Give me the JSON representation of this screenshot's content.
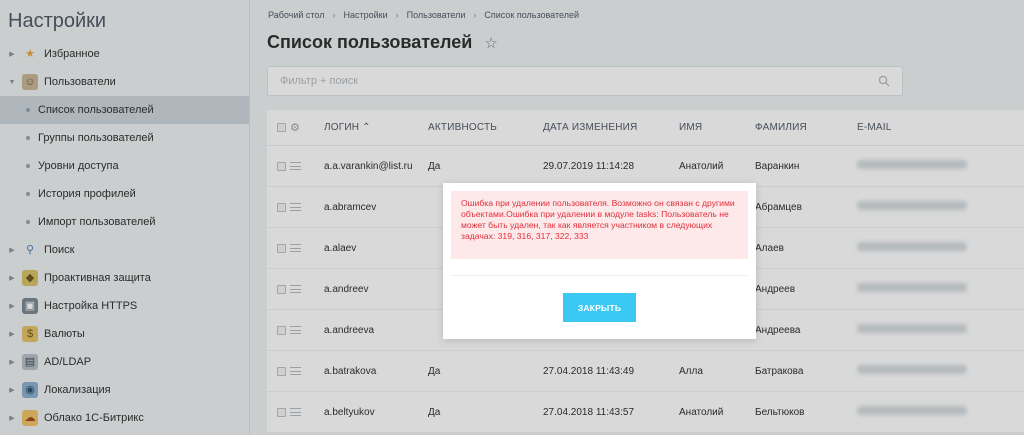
{
  "sidebar": {
    "title": "Настройки",
    "items": [
      {
        "label": "Избранное",
        "icon": "star-icon",
        "expanded": false
      },
      {
        "label": "Пользователи",
        "icon": "user-icon",
        "expanded": true
      },
      {
        "label": "Список пользователей",
        "sub": true,
        "active": true
      },
      {
        "label": "Группы пользователей",
        "sub": true
      },
      {
        "label": "Уровни доступа",
        "sub": true
      },
      {
        "label": "История профилей",
        "sub": true
      },
      {
        "label": "Импорт пользователей",
        "sub": true
      },
      {
        "label": "Поиск",
        "icon": "search-icon",
        "expanded": false
      },
      {
        "label": "Проактивная защита",
        "icon": "shield-icon",
        "expanded": false
      },
      {
        "label": "Настройка HTTPS",
        "icon": "lock-icon",
        "expanded": false
      },
      {
        "label": "Валюты",
        "icon": "currency-icon",
        "expanded": false
      },
      {
        "label": "AD/LDAP",
        "icon": "ldap-icon",
        "expanded": false
      },
      {
        "label": "Локализация",
        "icon": "globe-icon",
        "expanded": false
      },
      {
        "label": "Облако 1С-Битрикс",
        "icon": "cloud-icon",
        "expanded": false
      }
    ]
  },
  "breadcrumb": [
    "Рабочий стол",
    "Настройки",
    "Пользователи",
    "Список пользователей"
  ],
  "page": {
    "title": "Список пользователей"
  },
  "filter": {
    "placeholder": "Фильтр + поиск"
  },
  "table": {
    "columns": {
      "login": "ЛОГИН",
      "active": "АКТИВНОСТЬ",
      "date": "ДАТА ИЗМЕНЕНИЯ",
      "name": "ИМЯ",
      "last": "ФАМИЛИЯ",
      "email": "E-MAIL"
    },
    "rows": [
      {
        "login": "a.a.varankin@list.ru",
        "active": "Да",
        "date": "29.07.2019 11:14:28",
        "name": "Анатолий",
        "last": "Варанкин"
      },
      {
        "login": "a.abramcev",
        "active": "",
        "date": "",
        "name": "",
        "last": "Абрамцев"
      },
      {
        "login": "a.alaev",
        "active": "",
        "date": "",
        "name": "",
        "last": "Алаев"
      },
      {
        "login": "a.andreev",
        "active": "",
        "date": "",
        "name": "",
        "last": "Андреев"
      },
      {
        "login": "a.andreeva",
        "active": "",
        "date": "",
        "name": "",
        "last": "Андреева"
      },
      {
        "login": "a.batrakova",
        "active": "Да",
        "date": "27.04.2018 11:43:49",
        "name": "Алла",
        "last": "Батракова"
      },
      {
        "login": "a.beltyukov",
        "active": "Да",
        "date": "27.04.2018 11:43:57",
        "name": "Анатолий",
        "last": "Бельтюков"
      }
    ]
  },
  "modal": {
    "error": "Ошибка при удалении пользователя. Возможно он связан с другими объектами.Ошибка при удалении в модуле tasks: Пользователь не может быть удален, так как является участником в следующих задачах: 319, 316, 317, 322, 333",
    "close_label": "ЗАКРЫТЬ"
  },
  "colors": {
    "accent": "#3bc8f5",
    "error_text": "#e0303b",
    "error_bg": "#fde8ea"
  }
}
